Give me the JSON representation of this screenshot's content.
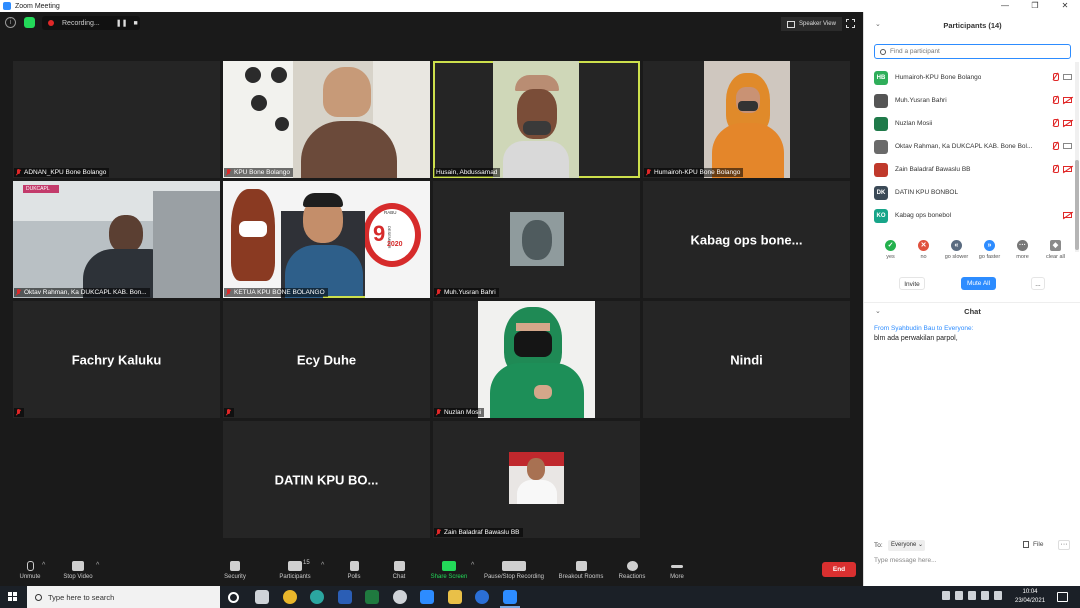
{
  "window": {
    "title": "Zoom Meeting"
  },
  "meeting": {
    "recording_label": "Recording...",
    "recording_pause": "❚❚",
    "recording_stop": "■",
    "view_mode": "Speaker View"
  },
  "tiles": [
    {
      "name": "ADNAN_KPU Bone Bolango"
    },
    {
      "name": "KPU Bone Bolango"
    },
    {
      "name": "Husain, Abdussamad"
    },
    {
      "name": "Humairoh-KPU Bone Bolango"
    },
    {
      "name": "Oktav Rahman, Ka DUKCAPL KAB. Bon..."
    },
    {
      "name": "KETUA KPU BONE BOLANGO"
    },
    {
      "name": "Muh.Yusran Bahri"
    },
    {
      "name": "",
      "display_name": "Kabag ops bone..."
    },
    {
      "name": "",
      "display_name": "Fachry Kaluku"
    },
    {
      "name": "",
      "display_name": "Ecy Duhe"
    },
    {
      "name": "Nuzlan Mosii"
    },
    {
      "name": "",
      "display_name": "Nindi"
    },
    {
      "name": "",
      "display_name": "DATIN KPU BO..."
    },
    {
      "name": "Zain Baladraf Bawaslu BB"
    }
  ],
  "tile_overlays": {
    "brand_logo": "DUKCAPL",
    "banner_day": "RABU",
    "banner_date": "9",
    "banner_month": "DESEMBER",
    "banner_year": "2020"
  },
  "toolbar": {
    "unmute": "Unmute",
    "stop_video": "Stop Video",
    "security": "Security",
    "participants": "Participants",
    "participants_count": "15",
    "polls": "Polls",
    "chat": "Chat",
    "share_screen": "Share Screen",
    "record": "Pause/Stop Recording",
    "breakout": "Breakout Rooms",
    "reactions": "Reactions",
    "more": "More",
    "end": "End"
  },
  "participants_panel": {
    "title": "Participants (14)",
    "search_placeholder": "Find a participant",
    "list": [
      {
        "initials": "HB",
        "name": "Humairoh-KPU Bone Bolango",
        "color": "#2fae5a"
      },
      {
        "initials": "",
        "name": "Muh.Yusran Bahri",
        "color": "#555555"
      },
      {
        "initials": "",
        "name": "Nuzlan Mosii",
        "color": "#1f7a4a"
      },
      {
        "initials": "",
        "name": "Oktav Rahman, Ka DUKCAPL KAB. Bone Bol...",
        "color": "#6a6a6a"
      },
      {
        "initials": "",
        "name": "Zain Baladraf Bawaslu BB",
        "color": "#c0392b"
      },
      {
        "initials": "DK",
        "name": "DATIN KPU BONBOL",
        "color": "#3b4a57"
      },
      {
        "initials": "KO",
        "name": "Kabag ops bonebol",
        "color": "#17a589"
      }
    ],
    "reactions": [
      {
        "label": "yes",
        "symbol": "✓",
        "color": "#23b14d"
      },
      {
        "label": "no",
        "symbol": "✕",
        "color": "#e0513d"
      },
      {
        "label": "go slower",
        "symbol": "«",
        "color": "#5a6b80"
      },
      {
        "label": "go faster",
        "symbol": "»",
        "color": "#2d8cff"
      },
      {
        "label": "more",
        "symbol": "···",
        "color": "#777777"
      },
      {
        "label": "clear all",
        "symbol": "◆",
        "color": "#8a8a8a"
      }
    ],
    "invite": "Invite",
    "mute_all": "Mute All",
    "more": "..."
  },
  "chat_panel": {
    "title": "Chat",
    "message_from": "From Syahbudin Bau to Everyone:",
    "message_text": "blm ada perwakilan parpol,",
    "to_label": "To:",
    "to_value": "Everyone ⌄",
    "file_label": "File",
    "more": "···",
    "input_placeholder": "Type message here..."
  },
  "taskbar": {
    "search_placeholder": "Type here to search",
    "time": "10:04",
    "date": "23/04/2021"
  }
}
